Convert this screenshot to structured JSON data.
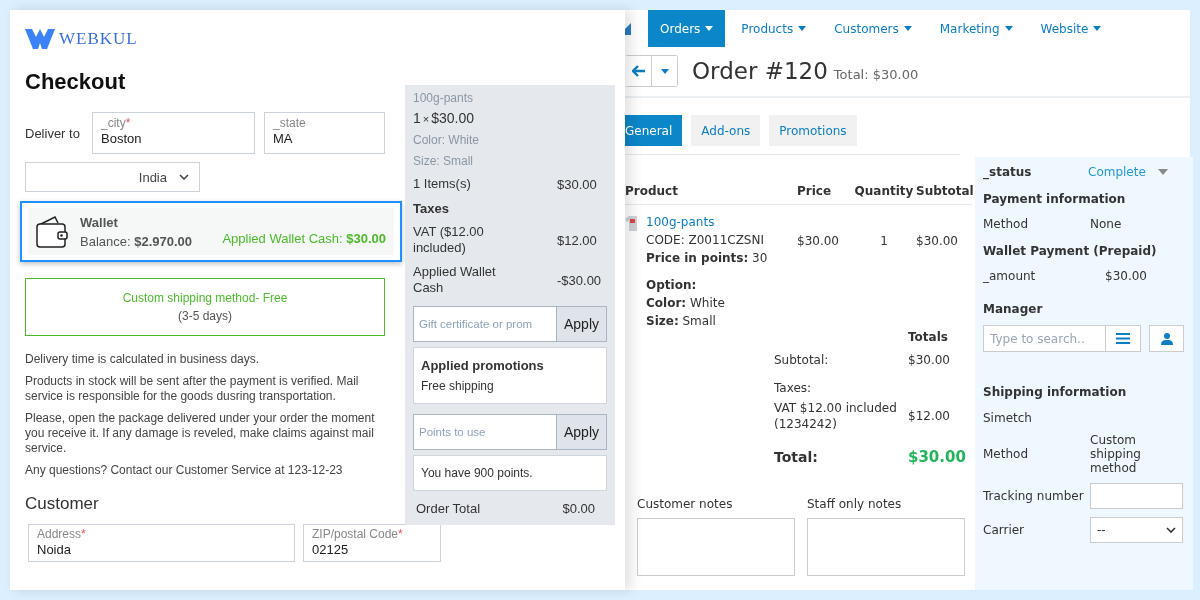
{
  "checkout": {
    "logo": "WEBKUL",
    "title": "Checkout",
    "deliver_label": "Deliver to",
    "address_fields": [
      {
        "label": "_city",
        "required_mark": "*",
        "value": "Boston"
      },
      {
        "label": "_state",
        "value": "MA"
      }
    ],
    "country": "India",
    "wallet": {
      "title": "Wallet",
      "balance": "Balance: **$2.970.00**",
      "applied": "Applied Wallet Cash: **$30.00**",
      "selected": true
    },
    "shipping": {
      "name": "Custom shipping method- Free",
      "days": "(3-5 days)",
      "selected": true
    },
    "notes": [
      "Delivery time is calculated in business days.",
      "Products in stock will be sent after the payment is verified. Mail service is responsible for the goods dusring transportation.",
      "Please, open the package delivered under your order the moment you receive it. If any damage is reveled, make claims against mail service.",
      "Any questions? Contact our Customer Service at 123-12-23"
    ],
    "customer_heading": "Customer",
    "customer_fields": [
      {
        "label": "Address",
        "required_mark": "*",
        "value": "Noida"
      },
      {
        "label": "ZIP/postal Code",
        "required_mark": "*",
        "value": "02125"
      }
    ]
  },
  "summary": {
    "product": "100g-pants",
    "quantity": "1",
    "times": "×",
    "price": "$30.00",
    "options": [
      "Color: White",
      "Size: Small"
    ],
    "lines": [
      {
        "kind": "line",
        "label": "1 Items(s)",
        "value": "$30.00"
      },
      {
        "kind": "heading",
        "label": "Taxes"
      },
      {
        "kind": "line",
        "label": "VAT ($12.00 included)",
        "value": "$12.00"
      },
      {
        "kind": "line",
        "label": "Applied Wallet Cash",
        "value": "-$30.00"
      }
    ],
    "promo": {
      "placeholder": "Gift certificate or prom",
      "button": "Apply"
    },
    "applied_promotions": {
      "title": "Applied promotions",
      "text": "Free shipping"
    },
    "points": {
      "placeholder": "Points to use",
      "button": "Apply",
      "note": "You have 900 points."
    },
    "total_label": "Order Total",
    "total_value": "$0.00"
  },
  "admin": {
    "nav": [
      {
        "label": "Orders",
        "selected": true
      },
      {
        "label": "Products",
        "selected": false
      },
      {
        "label": "Customers",
        "selected": false
      },
      {
        "label": "Marketing",
        "selected": false
      },
      {
        "label": "Website",
        "selected": false
      }
    ],
    "order_title": "Order #120",
    "order_total": "Total: $30.00",
    "tabs": [
      {
        "label": "General",
        "selected": true
      },
      {
        "label": "Add-ons",
        "selected": false
      },
      {
        "label": "Promotions",
        "selected": false
      }
    ],
    "table": {
      "columns": [
        "Product",
        "Price",
        "Quantity",
        "Subtotal"
      ],
      "rows": [
        {
          "name": "100g-pants",
          "code": "CODE: Z0011CZSNI",
          "points": "**Price in points:** 30",
          "option_heading": "Option:",
          "options": [
            "**Color:** White",
            "**Size:** Small"
          ],
          "price": "$30.00",
          "quantity": "1",
          "subtotal": "$30.00"
        }
      ]
    },
    "totals": {
      "heading": "Totals",
      "rows": [
        {
          "kind": "line",
          "label": "Subtotal:",
          "value": "$30.00"
        },
        {
          "kind": "heading",
          "label": "Taxes:"
        },
        {
          "kind": "line",
          "label": "VAT $12.00 included (1234242)",
          "value": "$12.00"
        },
        {
          "kind": "total",
          "label": "Total:",
          "value": "$30.00"
        }
      ]
    },
    "notes": [
      "Customer notes",
      "Staff only notes"
    ],
    "sidebar": {
      "status_label": "_status",
      "status": "Complete",
      "payment_heading": "Payment information",
      "payment_method_label": "Method",
      "payment_method": "None",
      "wallet_heading": "Wallet Payment (Prepaid)",
      "amount_label": "_amount",
      "amount": "$30.00",
      "manager_heading": "Manager",
      "manager_placeholder": "Type to search..",
      "shipping_heading": "Shipping information",
      "shipping_name": "Simetch",
      "shipping_method_label": "Method",
      "shipping_method": "Custom shipping method",
      "tracking_label": "Tracking number",
      "carrier_label": "Carrier",
      "carrier": "--"
    }
  }
}
